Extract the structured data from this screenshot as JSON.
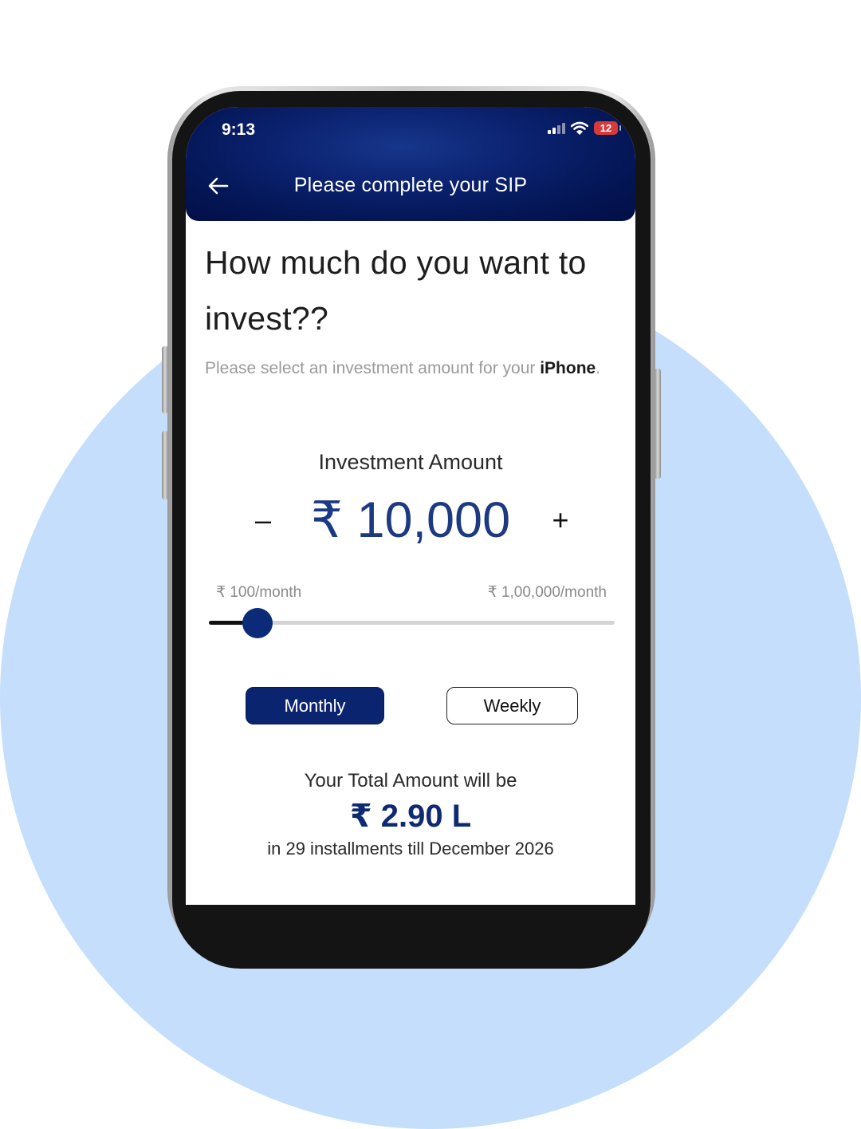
{
  "colors": {
    "background_circle": "#c4defb",
    "header_dark": "#041656",
    "accent_navy": "#0b2470",
    "amount_text": "#1c3a82",
    "battery_red": "#d63a3a"
  },
  "status_bar": {
    "time": "9:13",
    "battery_level": "12",
    "icons": [
      "signal-icon",
      "wifi-icon",
      "battery-icon"
    ]
  },
  "header": {
    "back_icon": "arrow-left-icon",
    "title": "Please complete your SIP"
  },
  "main": {
    "heading": "How much do you want to invest??",
    "subtext_prefix": "Please select an investment amount for your ",
    "subtext_product": "iPhone",
    "subtext_suffix": ".",
    "amount_label": "Investment Amount",
    "decrement_label": "–",
    "amount_value": "₹ 10,000",
    "increment_label": "+",
    "range_min_label": "₹ 100/month",
    "range_max_label": "₹ 1,00,000/month",
    "slider_fraction": 0.1,
    "frequency_options": [
      {
        "label": "Monthly",
        "selected": true
      },
      {
        "label": "Weekly",
        "selected": false
      }
    ],
    "total_label": "Your Total Amount will be",
    "total_value": "₹ 2.90 L",
    "installments_text": "in 29 installments till December 2026"
  }
}
